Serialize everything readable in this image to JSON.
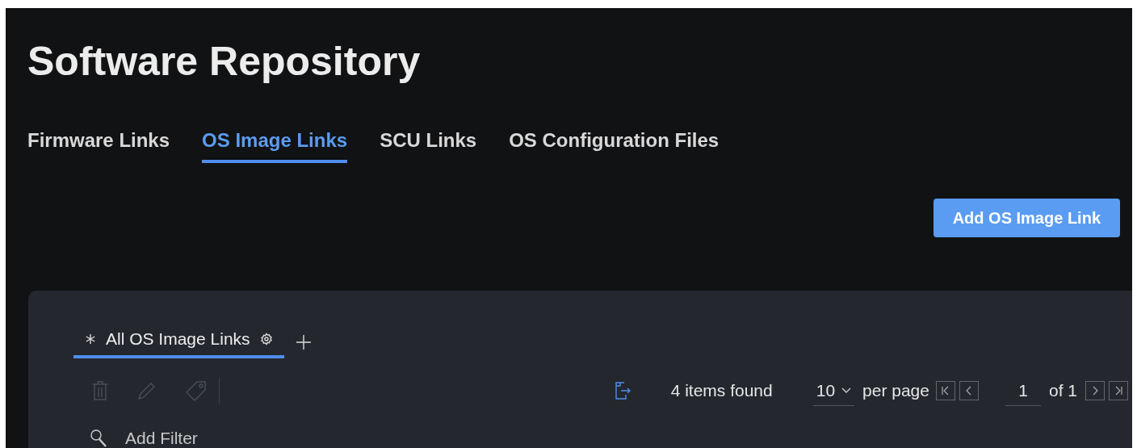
{
  "page_title": "Software Repository",
  "tabs": [
    {
      "label": "Firmware Links",
      "selected": false
    },
    {
      "label": "OS Image Links",
      "selected": true
    },
    {
      "label": "SCU Links",
      "selected": false
    },
    {
      "label": "OS Configuration Files",
      "selected": false
    }
  ],
  "primary_button": "Add OS Image Link",
  "views": [
    {
      "label": "All OS Image Links",
      "selected": true
    }
  ],
  "actions": [
    {
      "kind": "delete",
      "disabled": true
    },
    {
      "kind": "edit",
      "disabled": true
    },
    {
      "kind": "tag",
      "disabled": true
    }
  ],
  "results": {
    "count": "4 items found",
    "per_page": "10",
    "per_page_label": "per page",
    "page": "1",
    "page_total": "of 1"
  },
  "filter": {
    "placeholder": "Add Filter"
  }
}
